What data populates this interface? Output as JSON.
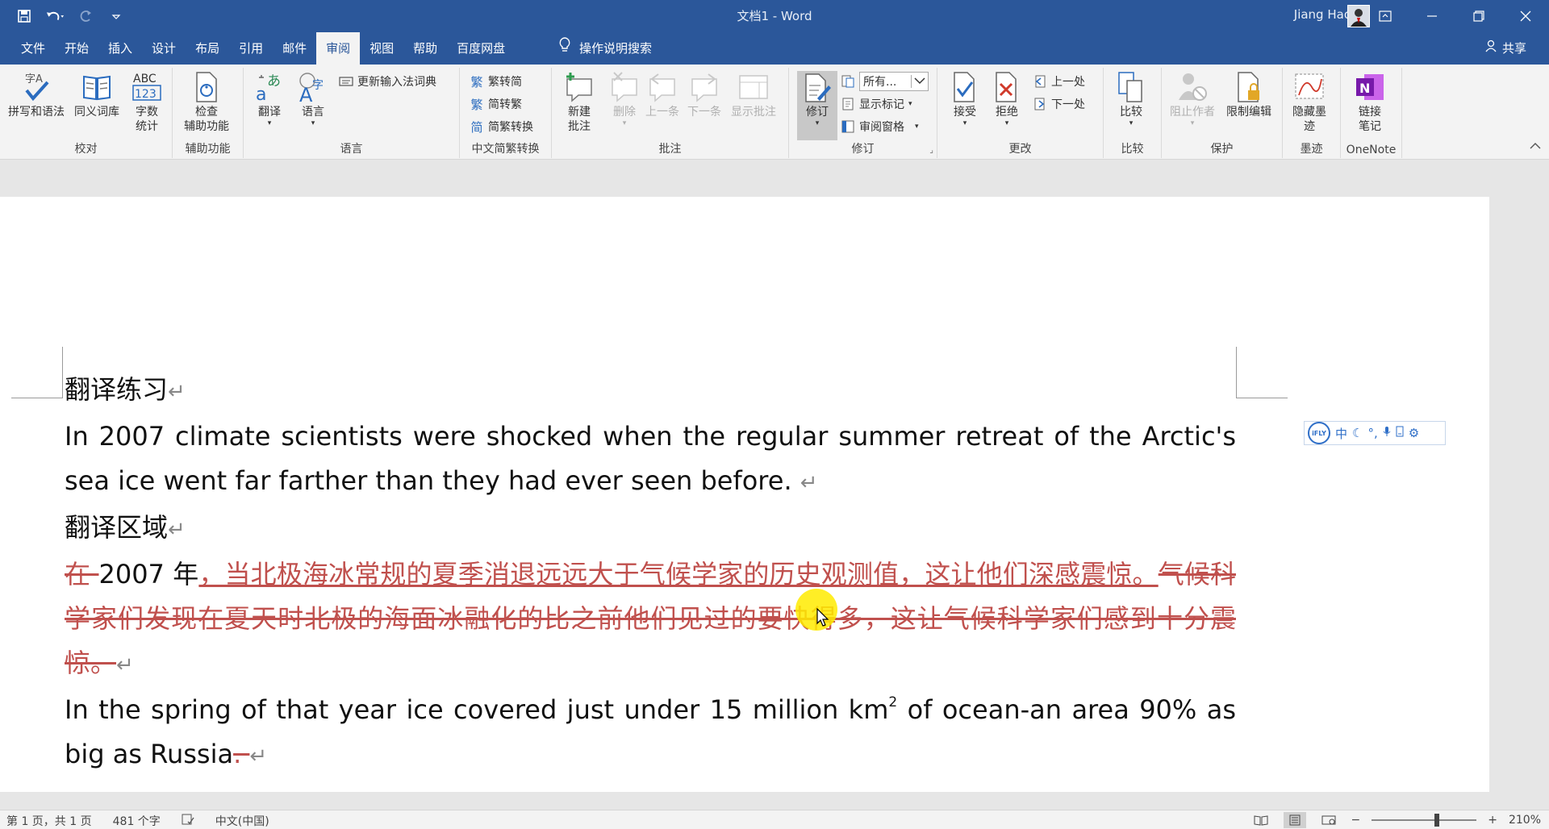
{
  "window": {
    "title": "文档1  -  Word",
    "user_name": "Jiang Hao"
  },
  "tabs": [
    {
      "label": "文件"
    },
    {
      "label": "开始"
    },
    {
      "label": "插入"
    },
    {
      "label": "设计"
    },
    {
      "label": "布局"
    },
    {
      "label": "引用"
    },
    {
      "label": "邮件"
    },
    {
      "label": "审阅",
      "active": true
    },
    {
      "label": "视图"
    },
    {
      "label": "帮助"
    },
    {
      "label": "百度网盘"
    }
  ],
  "tellme": "操作说明搜索",
  "share": "共享",
  "ribbon": {
    "proofing": {
      "label": "校对",
      "spelling": "拼写和语法",
      "thesaurus": "同义词库",
      "wordcount": "字数\n统计"
    },
    "accessibility": {
      "label": "辅助功能",
      "check": "检查\n辅助功能"
    },
    "language": {
      "label": "语言",
      "translate": "翻译",
      "language": "语言",
      "update_ime": "更新输入法词典"
    },
    "chinese": {
      "label": "中文简繁转换",
      "to_simplified": "繁转简",
      "to_traditional": "简转繁",
      "convert": "简繁转换"
    },
    "comments": {
      "label": "批注",
      "new": "新建\n批注",
      "delete": "删除",
      "prev": "上一条",
      "next": "下一条",
      "show": "显示批注"
    },
    "tracking": {
      "label": "修订",
      "track": "修订",
      "markup_select": "所有...",
      "show_markup": "显示标记",
      "pane": "审阅窗格"
    },
    "changes": {
      "label": "更改",
      "accept": "接受",
      "reject": "拒绝",
      "prev": "上一处",
      "next": "下一处"
    },
    "compare": {
      "label": "比较",
      "compare": "比较"
    },
    "protect": {
      "label": "保护",
      "block_authors": "阻止作者",
      "restrict": "限制编辑"
    },
    "ink": {
      "label": "墨迹",
      "hide_ink": "隐藏墨\n迹"
    },
    "onenote": {
      "label": "OneNote",
      "link": "链接\n笔记"
    }
  },
  "document": {
    "heading1": "翻译练习",
    "para1": "In 2007 climate scientists were shocked when the regular summer retreat of the Arctic's sea ice went far farther than they had ever seen before. ",
    "heading2": "翻译区域",
    "para2_del1": "在 ",
    "para2_plain": "2007 年",
    "para2_ins": "，当北极海冰常规的夏季消退远远大于气候学家的历史观测值，这让他们深感震惊。",
    "para2_del2": "气候科学家们发现在夏天时北极的海面冰融化的比之前他们见过的要快得多，这让气候科学家们感到十分震惊。",
    "para3_a": "In the spring of that year ice covered just under 15 million km",
    "para3_sup": "2",
    "para3_b": " of ocean-an area 90% as big as Russia",
    "para3_del": ". ",
    "pilcrow": "↵"
  },
  "ime": {
    "mode": "中"
  },
  "status": {
    "page": "第 1 页，共 1 页",
    "words": "481 个字",
    "language": "中文(中国)",
    "zoom": "210%"
  }
}
